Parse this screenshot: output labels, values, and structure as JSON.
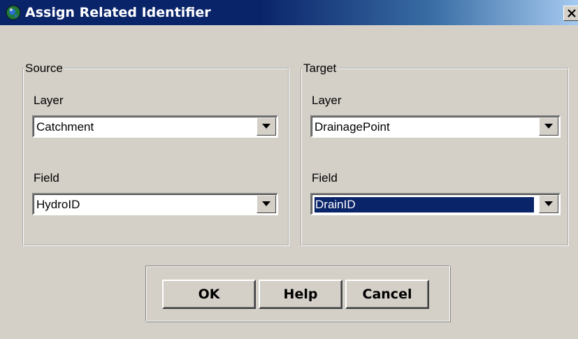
{
  "window": {
    "title": "Assign Related Identifier"
  },
  "source": {
    "legend": "Source",
    "layer_label": "Layer",
    "layer_value": "Catchment",
    "field_label": "Field",
    "field_value": "HydroID"
  },
  "target": {
    "legend": "Target",
    "layer_label": "Layer",
    "layer_value": "DrainagePoint",
    "field_label": "Field",
    "field_value": "DrainID"
  },
  "buttons": {
    "ok": "OK",
    "help": "Help",
    "cancel": "Cancel"
  },
  "colors": {
    "title_bar": "#0a246a",
    "dialog_face": "#d4d0c8",
    "selection": "#0a246a"
  }
}
